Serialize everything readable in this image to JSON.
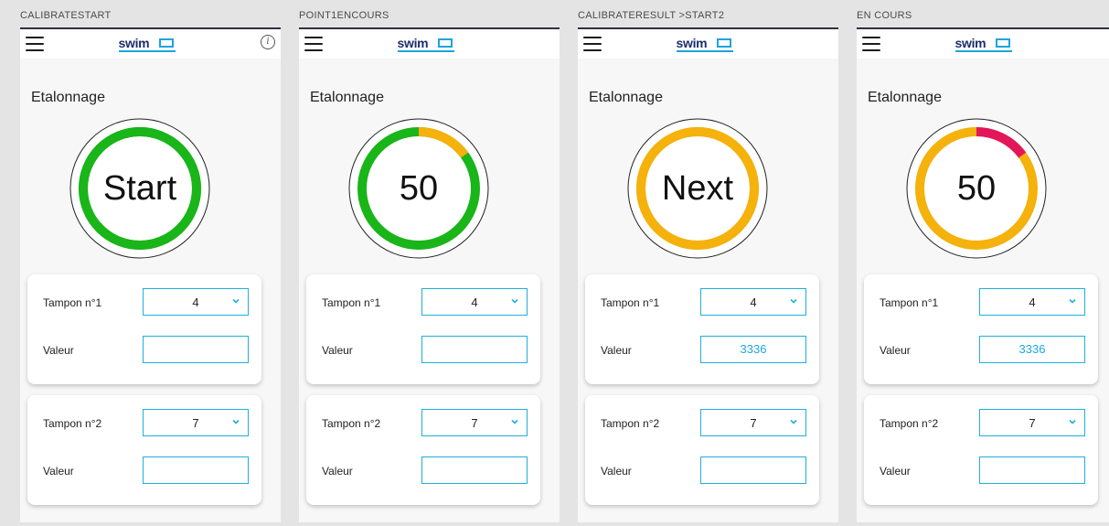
{
  "brand": {
    "logo_text": "swim",
    "accent_color": "#1fb0dd"
  },
  "screens": [
    {
      "label": "CALIBRATESTART",
      "title": "Etalonnage",
      "gauge": {
        "text": "Start",
        "ring_color": "#19b519",
        "progress_color": "#19b519",
        "progress": 1.0,
        "show_info": true
      },
      "buffer1": {
        "label": "Tampon n°1",
        "value": "4",
        "valeur_label": "Valeur",
        "valeur": ""
      },
      "buffer2": {
        "label": "Tampon n°2",
        "value": "7",
        "valeur_label": "Valeur",
        "valeur": ""
      }
    },
    {
      "label": "POINT1ENCOURS",
      "title": "Etalonnage",
      "gauge": {
        "text": "50",
        "ring_color": "#19b519",
        "progress_color": "#f5b10c",
        "progress": 0.15,
        "show_info": false
      },
      "buffer1": {
        "label": "Tampon n°1",
        "value": "4",
        "valeur_label": "Valeur",
        "valeur": ""
      },
      "buffer2": {
        "label": "Tampon n°2",
        "value": "7",
        "valeur_label": "Valeur",
        "valeur": ""
      }
    },
    {
      "label": "CALIBRATERESULT >START2",
      "title": "Etalonnage",
      "gauge": {
        "text": "Next",
        "ring_color": "#f5b10c",
        "progress_color": "#f5b10c",
        "progress": 1.0,
        "show_info": false
      },
      "buffer1": {
        "label": "Tampon n°1",
        "value": "4",
        "valeur_label": "Valeur",
        "valeur": "3336"
      },
      "buffer2": {
        "label": "Tampon n°2",
        "value": "7",
        "valeur_label": "Valeur",
        "valeur": ""
      }
    },
    {
      "label": "EN COURS",
      "title": "Etalonnage",
      "gauge": {
        "text": "50",
        "ring_color": "#f5b10c",
        "progress_color": "#e3165b",
        "progress": 0.15,
        "show_info": false
      },
      "buffer1": {
        "label": "Tampon n°1",
        "value": "4",
        "valeur_label": "Valeur",
        "valeur": "3336"
      },
      "buffer2": {
        "label": "Tampon n°2",
        "value": "7",
        "valeur_label": "Valeur",
        "valeur": ""
      }
    }
  ]
}
